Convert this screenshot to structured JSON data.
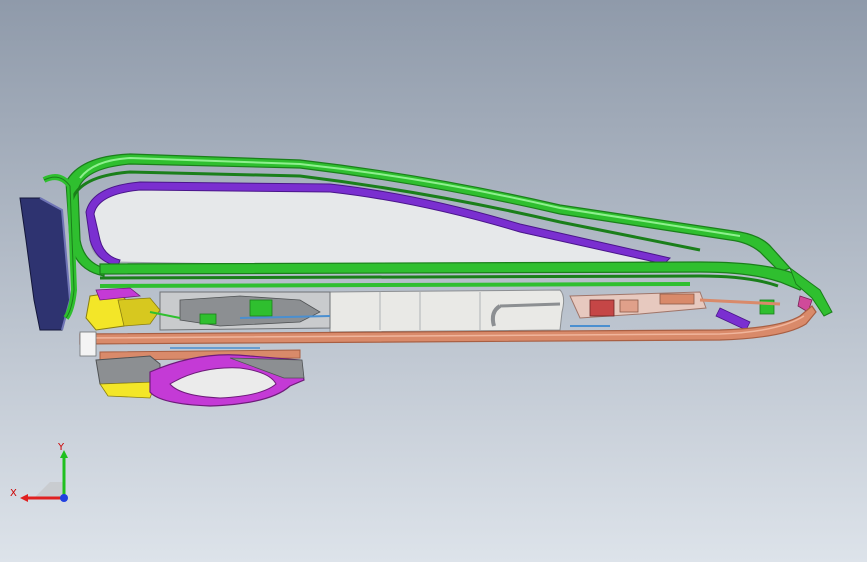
{
  "viewport": {
    "background_top": "#8f9aaa",
    "background_bottom": "#dde3ea"
  },
  "model": {
    "frame_color": "#2fbf2f",
    "frame_dark": "#1a7f1a",
    "inner_frame_color": "#7a2fd0",
    "panel_color": "#e6e8ea",
    "rail_color": "#d98a6a",
    "rail_dark": "#a85f43",
    "tray_color": "#e9e9e6",
    "handle_color": "#c43ad6",
    "handle_inner": "#ebebeb",
    "bracket_yellow": "#f3e628",
    "end_panel_color": "#2e3370",
    "mechanism_gray": "#8c8f92"
  },
  "triad": {
    "x_label": "X",
    "y_label": "Y",
    "x_color": "#e02020",
    "y_color": "#20c020",
    "z_color": "#2040e0"
  }
}
